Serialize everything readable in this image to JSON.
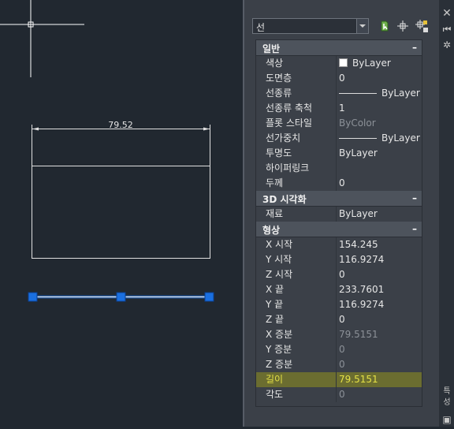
{
  "object_selector": {
    "value": "선"
  },
  "toolbar": {
    "quick_select_icon": "quick-select-icon",
    "select_objects_icon": "select-objects-icon",
    "pickadd_icon": "pickadd-toggle-icon"
  },
  "drawing": {
    "dimension_text": "79.52",
    "selected_line_grip_color": "#1a6fe0",
    "crosshair_color": "#ffffff"
  },
  "sections": [
    {
      "title": "일반",
      "collapse": "–",
      "rows": [
        {
          "label": "색상",
          "value": "ByLayer",
          "swatch": true
        },
        {
          "label": "도면층",
          "value": "0"
        },
        {
          "label": "선종류",
          "value": "ByLayer",
          "linetype": true
        },
        {
          "label": "선종류 축척",
          "value": "1"
        },
        {
          "label": "플롯 스타일",
          "value": "ByColor",
          "dim": true
        },
        {
          "label": "선가중치",
          "value": "ByLayer",
          "linetype": true
        },
        {
          "label": "투명도",
          "value": "ByLayer"
        },
        {
          "label": "하이퍼링크",
          "value": ""
        },
        {
          "label": "두께",
          "value": "0"
        }
      ]
    },
    {
      "title": "3D 시각화",
      "collapse": "–",
      "rows": [
        {
          "label": "재료",
          "value": "ByLayer"
        }
      ]
    },
    {
      "title": "형상",
      "collapse": "–",
      "rows": [
        {
          "label": "X 시작",
          "value": "154.245"
        },
        {
          "label": "Y 시작",
          "value": "116.9274"
        },
        {
          "label": "Z 시작",
          "value": "0"
        },
        {
          "label": "X 끝",
          "value": "233.7601"
        },
        {
          "label": "Y 끝",
          "value": "116.9274"
        },
        {
          "label": "Z 끝",
          "value": "0"
        },
        {
          "label": "X 증분",
          "value": "79.5151",
          "dim": true
        },
        {
          "label": "Y 증분",
          "value": "0",
          "dim": true
        },
        {
          "label": "Z 증분",
          "value": "0",
          "dim": true
        },
        {
          "label": "길이",
          "value": "79.5151",
          "dim": true,
          "highlight": true
        },
        {
          "label": "각도",
          "value": "0",
          "dim": true
        }
      ]
    }
  ],
  "side_strip": {
    "close_icon": "close-icon",
    "autohide_icon": "auto-hide-icon",
    "settings_icon": "settings-icon",
    "bottom_label": "특성"
  },
  "colors": {
    "highlight": "#93921d",
    "highlight_text": "#e5e146",
    "canvas_background": "#212830"
  }
}
